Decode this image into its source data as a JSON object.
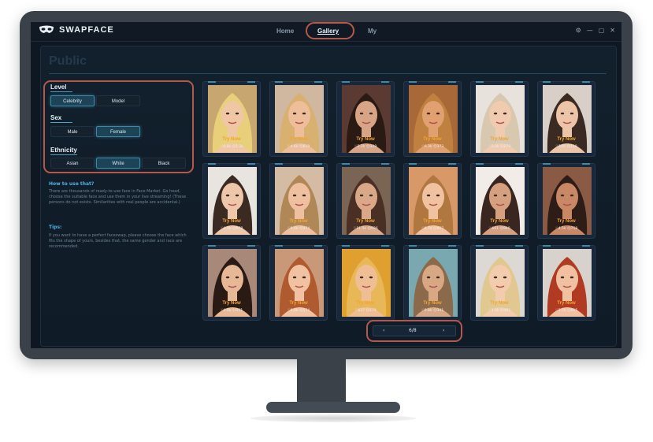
{
  "app": {
    "logo_text": "SWAPFACE"
  },
  "nav": {
    "home": "Home",
    "gallery": "Gallery",
    "my": "My"
  },
  "window_controls": {
    "settings": "⚙",
    "minimize": "—",
    "maximize": "▢",
    "close": "✕"
  },
  "section_title": "Public",
  "filters": {
    "level": {
      "label": "Level",
      "options": [
        "Celebrity",
        "Model"
      ],
      "selected": "Celebrity"
    },
    "sex": {
      "label": "Sex",
      "options": [
        "Male",
        "Female"
      ],
      "selected": "Female"
    },
    "ethnicity": {
      "label": "Ethnicity",
      "options": [
        "Asian",
        "White",
        "Black"
      ],
      "selected": "White"
    }
  },
  "help": {
    "how_title": "How to use that?",
    "how_body": "There are thousands of ready-to-use face in Face Market. Go head, choose the suitable face and use them in your live streaming! (These persons do not exists. Similarities with real people are accidental.)",
    "tips_title": "Tips:",
    "tips_body": "If you want to have a perfect faceswap, please choose the face which fits the shape of yours, besides that, the same gender and race are recommended."
  },
  "cards": [
    {
      "try": "Try Now",
      "stats": "♡8.0k ☺1.3k",
      "hair": "#e8cf7a",
      "skin": "#f0c7a4",
      "bg": "#c8a670"
    },
    {
      "try": "Try Now",
      "stats": "♡4.6k ☺819",
      "hair": "#d8b070",
      "skin": "#eebd9a",
      "bg": "#d0b8a0"
    },
    {
      "try": "Try Now",
      "stats": "♡2.2k ☺329",
      "hair": "#2a1a14",
      "skin": "#d7a486",
      "bg": "#5b3a34"
    },
    {
      "try": "Try Now",
      "stats": "♡6.3k ☺373",
      "hair": "#c08040",
      "skin": "#e0a070",
      "bg": "#a86838"
    },
    {
      "try": "Try Now",
      "stats": "♡5.0k ☺279",
      "hair": "#d8c8b0",
      "skin": "#f0cbb0",
      "bg": "#e8e2dc"
    },
    {
      "try": "Try Now",
      "stats": "♡105 ☺150",
      "hair": "#3a2a22",
      "skin": "#ecc4a8",
      "bg": "#d8d0c8"
    },
    {
      "try": "Try Now",
      "stats": "♡4.9k ☺978",
      "hair": "#3b2a22",
      "skin": "#eec6aa",
      "bg": "#e8e4e0"
    },
    {
      "try": "Try Now",
      "stats": "♡9.6k ☺474",
      "hair": "#b08858",
      "skin": "#eec0a0",
      "bg": "#d4bca4"
    },
    {
      "try": "Try Now",
      "stats": "♡11.5k ☺626",
      "hair": "#4a3024",
      "skin": "#d8a888",
      "bg": "#7a6454"
    },
    {
      "try": "Try Now",
      "stats": "♡6.7k ☺457",
      "hair": "#b07840",
      "skin": "#f0c2a0",
      "bg": "#d89868"
    },
    {
      "try": "Try Now",
      "stats": "♡661 ☺840",
      "hair": "#3a2620",
      "skin": "#d4a080",
      "bg": "#f2ece8"
    },
    {
      "try": "Try Now",
      "stats": "♡4.5k ☺758",
      "hair": "#2e1c16",
      "skin": "#c88866",
      "bg": "#8a5a44"
    },
    {
      "try": "Try Now",
      "stats": "♡4.8k ☺351",
      "hair": "#2a1a14",
      "skin": "#e6b896",
      "bg": "#a88878"
    },
    {
      "try": "Try Now",
      "stats": "♡8.8k ☺574",
      "hair": "#b05a30",
      "skin": "#f0c2a2",
      "bg": "#c89878"
    },
    {
      "try": "Try Now",
      "stats": "♡627 ☺179",
      "hair": "#e8b858",
      "skin": "#f0be94",
      "bg": "#e0a030"
    },
    {
      "try": "Try Now",
      "stats": "♡9.8k ☺341",
      "hair": "#8a6a4a",
      "skin": "#d8a884",
      "bg": "#7aa8b0"
    },
    {
      "try": "Try Now",
      "stats": "♡1.0k ☺481",
      "hair": "#e0c890",
      "skin": "#f2ccac",
      "bg": "#dcd8d4"
    },
    {
      "try": "Try Now",
      "stats": "♡3.7k ☺815",
      "hair": "#b03a22",
      "skin": "#f0c0a0",
      "bg": "#d8d2cc"
    }
  ],
  "pagination": {
    "prev": "‹",
    "page": "6/8",
    "next": "›"
  }
}
